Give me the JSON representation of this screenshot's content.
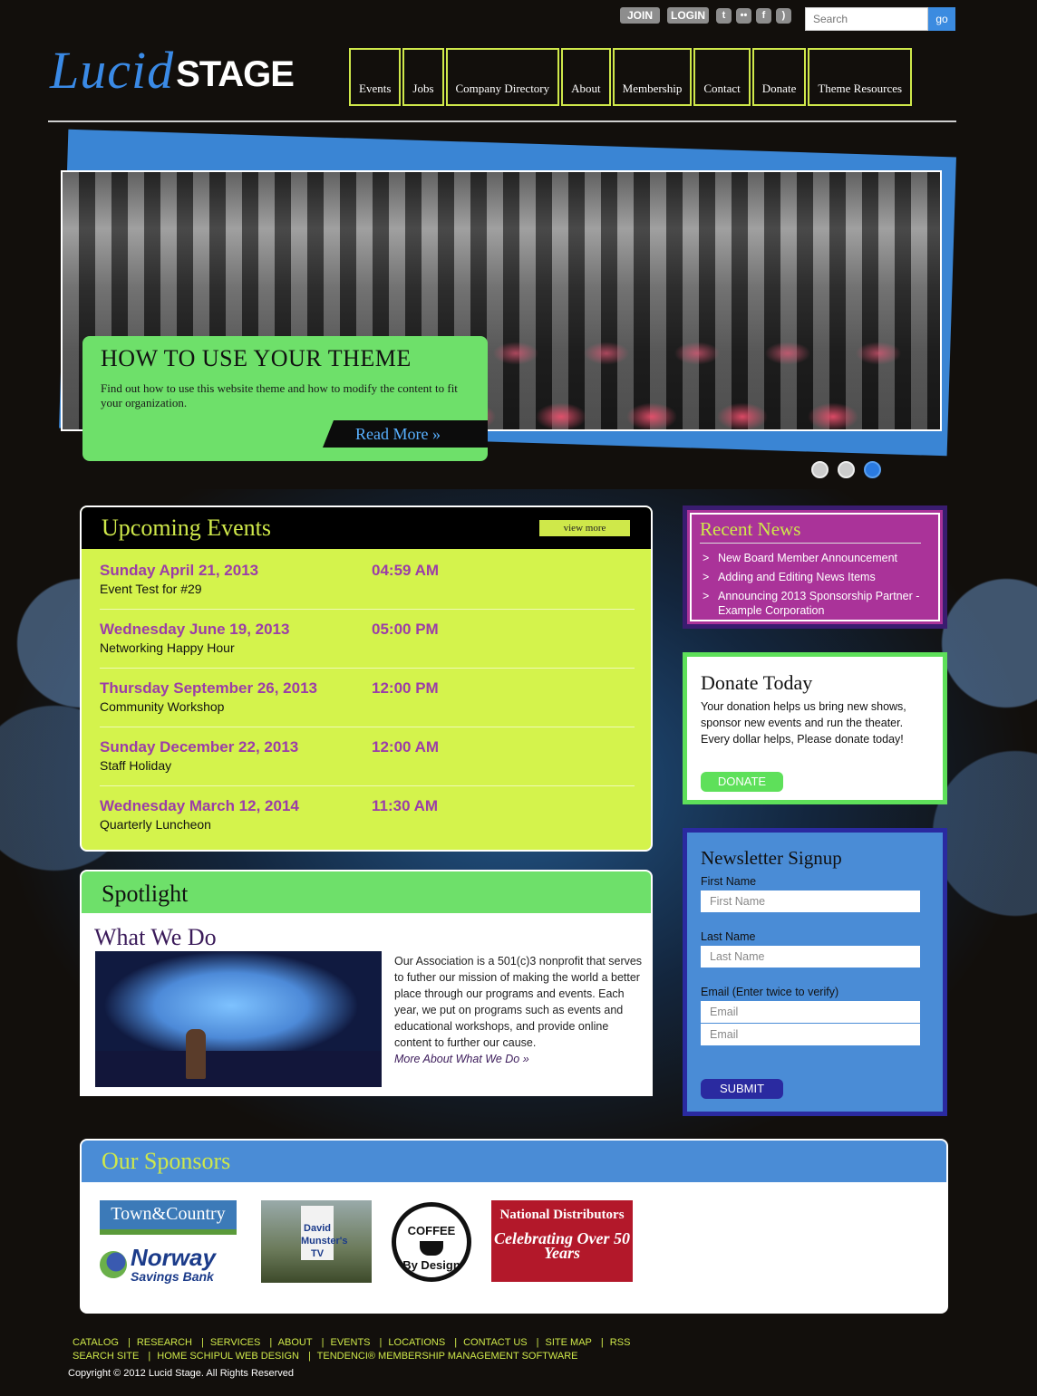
{
  "header": {
    "join_label": "JOIN",
    "login_label": "LOGIN",
    "social_icons": [
      "twitter-icon",
      "flickr-icon",
      "facebook-icon",
      "rss-icon"
    ],
    "search_placeholder": "Search",
    "search_button": "go",
    "logo_lucid": "Lucid",
    "logo_stage": "STAGE",
    "nav": [
      "Events",
      "Jobs",
      "Company Directory",
      "About",
      "Membership",
      "Contact",
      "Donate",
      "Theme Resources"
    ]
  },
  "hero": {
    "title": "HOW TO USE YOUR THEME",
    "text": "Find out how to use this website theme and how to modify the content to fit your organization.",
    "read_more": "Read More »",
    "slides": 3,
    "active_slide": 3
  },
  "events": {
    "title": "Upcoming Events",
    "view_more": "view more",
    "items": [
      {
        "date": "Sunday April 21, 2013",
        "time": "04:59 AM",
        "name": "Event Test for #29"
      },
      {
        "date": "Wednesday June 19, 2013",
        "time": "05:00 PM",
        "name": "Networking Happy Hour"
      },
      {
        "date": "Thursday September 26, 2013",
        "time": "12:00 PM",
        "name": "Community Workshop"
      },
      {
        "date": "Sunday December 22, 2013",
        "time": "12:00 AM",
        "name": "Staff Holiday"
      },
      {
        "date": "Wednesday March 12, 2014",
        "time": "11:30 AM",
        "name": "Quarterly Luncheon"
      }
    ]
  },
  "spotlight": {
    "title": "Spotlight",
    "subtitle": "What We Do",
    "text": "Our Association is a 501(c)3 nonprofit that serves to futher our mission of making the world a better place through our programs and events. Each year, we put on programs such as events and educational workshops, and provide online content to further our cause.",
    "link": "More About What We Do »"
  },
  "news": {
    "title": "Recent News",
    "items": [
      "New Board Member Announcement",
      "Adding and Editing News Items",
      "Announcing 2013 Sponsorship Partner - Example Corporation"
    ]
  },
  "donate": {
    "title": "Donate Today",
    "text": "Your donation helps us bring new shows, sponsor new events and run the theater. Every dollar helps, Please donate today!",
    "button": "DONATE"
  },
  "newsletter": {
    "title": "Newsletter Signup",
    "first_label": "First Name",
    "first_placeholder": "First Name",
    "last_label": "Last Name",
    "last_placeholder": "Last Name",
    "email_label": "Email (Enter twice to verify)",
    "email_placeholder": "Email",
    "email2_placeholder": "Email",
    "submit": "SUBMIT"
  },
  "sponsors": {
    "title": "Our Sponsors",
    "logo1": "Town&Country",
    "logo2_main": "Norway",
    "logo2_sub": "Savings Bank",
    "logo3": "David Munster's TV",
    "logo4_top": "COFFEE",
    "logo4_bottom": "By Design",
    "logo5_main": "National Distributors",
    "logo5_sub": "Celebrating Over 50 Years"
  },
  "footer": {
    "row1": [
      "CATALOG",
      "RESEARCH",
      "SERVICES",
      "ABOUT",
      "EVENTS",
      "LOCATIONS",
      "CONTACT US",
      "SITE MAP",
      "RSS"
    ],
    "row2": [
      "SEARCH SITE",
      "HOME SCHIPUL WEB DESIGN",
      "TENDENCI® MEMBERSHIP MANAGEMENT SOFTWARE"
    ],
    "copyright": "Copyright © 2012 Lucid Stage. All Rights Reserved"
  }
}
